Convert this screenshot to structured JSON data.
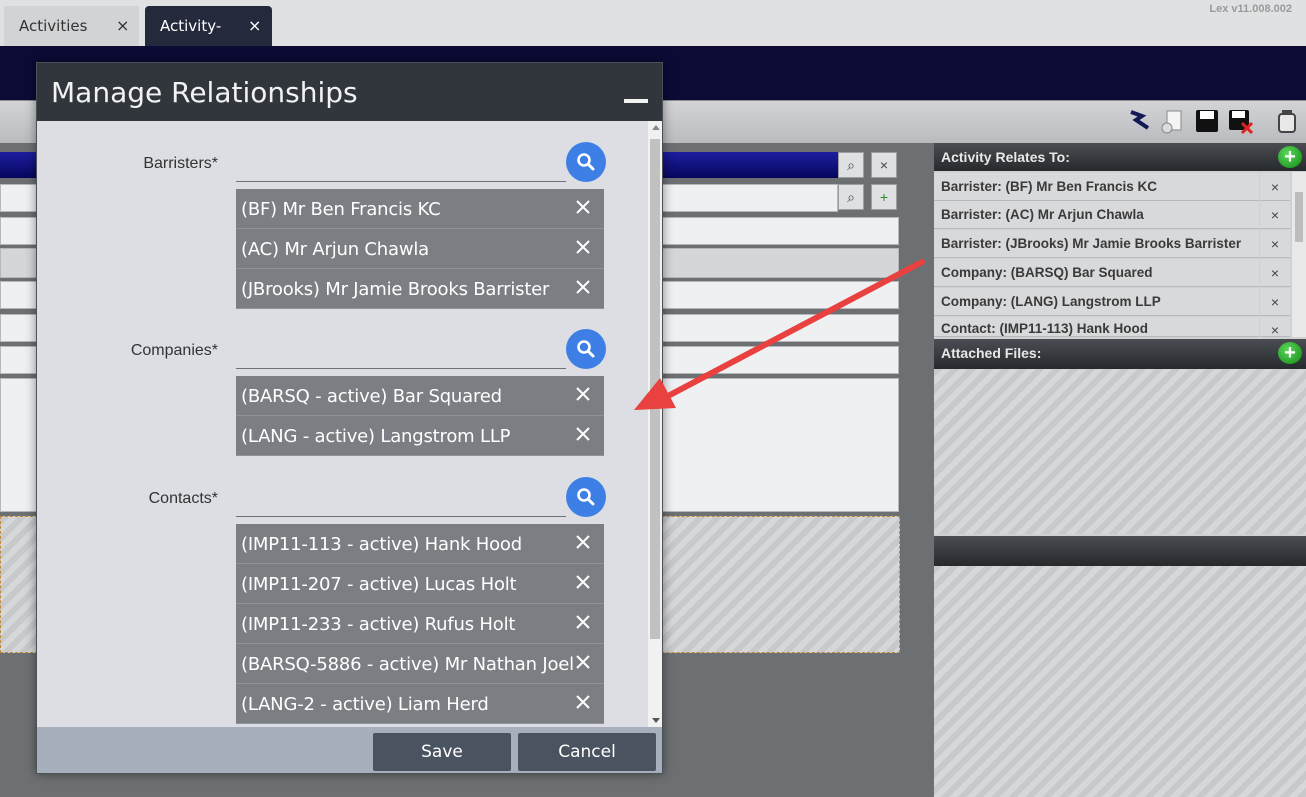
{
  "tabs": [
    {
      "label": "Activities",
      "close": "×"
    },
    {
      "label": "Activity-",
      "close": "×"
    }
  ],
  "version": "Lex v11.008.002",
  "right_panel": {
    "relates_title": "Activity Relates To:",
    "relations": [
      "Barrister: (BF) Mr Ben Francis KC",
      "Barrister: (AC) Mr Arjun Chawla",
      "Barrister: (JBrooks) Mr Jamie Brooks Barrister",
      "Company: (BARSQ) Bar Squared",
      "Company: (LANG) Langstrom LLP",
      "Contact: (IMP11-113) Hank Hood"
    ],
    "remove_glyph": "×",
    "add_glyph": "+",
    "files_title": "Attached Files:"
  },
  "modal": {
    "title": "Manage Relationships",
    "barristers_label": "Barristers*",
    "barristers": [
      "(BF) Mr Ben Francis KC",
      "(AC) Mr Arjun Chawla",
      "(JBrooks) Mr Jamie Brooks Barrister"
    ],
    "companies_label": "Companies*",
    "companies": [
      "(BARSQ - active) Bar Squared",
      "(LANG - active) Langstrom LLP"
    ],
    "contacts_label": "Contacts*",
    "contacts": [
      "(IMP11-113 - active) Hank Hood",
      "(IMP11-207 - active) Lucas Holt",
      "(IMP11-233 - active) Rufus Holt",
      "(BARSQ-5886 - active) Mr Nathan Joel",
      "(LANG-2 - active) Liam Herd"
    ],
    "save_label": "Save",
    "cancel_label": "Cancel"
  },
  "colors": {
    "accent_search": "#3e7fe6",
    "arrow": "#e8413f",
    "modal_header": "#31363d",
    "chip": "#7b7f83"
  }
}
